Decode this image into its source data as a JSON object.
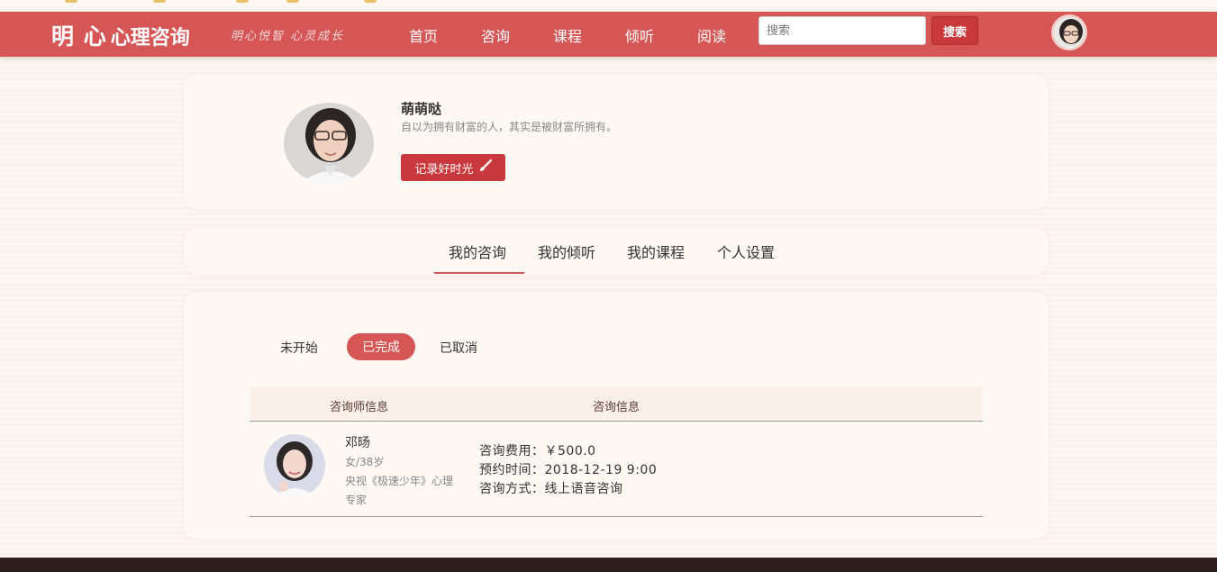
{
  "header": {
    "brand_main": "明 心",
    "brand_sub": "心理咨询",
    "slogan": "明心悦智 心灵成长",
    "nav": [
      "首页",
      "咨询",
      "课程",
      "倾听",
      "阅读"
    ],
    "search_placeholder": "搜索",
    "search_button": "搜索"
  },
  "profile": {
    "name": "萌萌哒",
    "motto": "自以为拥有财富的人，其实是被财富所拥有。",
    "record_button": "记录好时光"
  },
  "tabs": [
    "我的咨询",
    "我的倾听",
    "我的课程",
    "个人设置"
  ],
  "active_tab": "我的咨询",
  "status_tabs": [
    "未开始",
    "已完成",
    "已取消"
  ],
  "active_status": "已完成",
  "table": {
    "headers": [
      "咨询师信息",
      "咨询信息"
    ],
    "rows": [
      {
        "name": "邓旸",
        "meta": "女/38岁",
        "desc": "央视《极速少年》心理专家",
        "fee": "咨询费用：￥500.0",
        "time": "预约时间：2018-12-19 9:00",
        "method": "咨询方式：线上语音咨询"
      }
    ]
  },
  "colors": {
    "brand": "#d65656",
    "button": "#c9383c",
    "background": "#fbf2ec",
    "footer": "#2d1d1d"
  }
}
